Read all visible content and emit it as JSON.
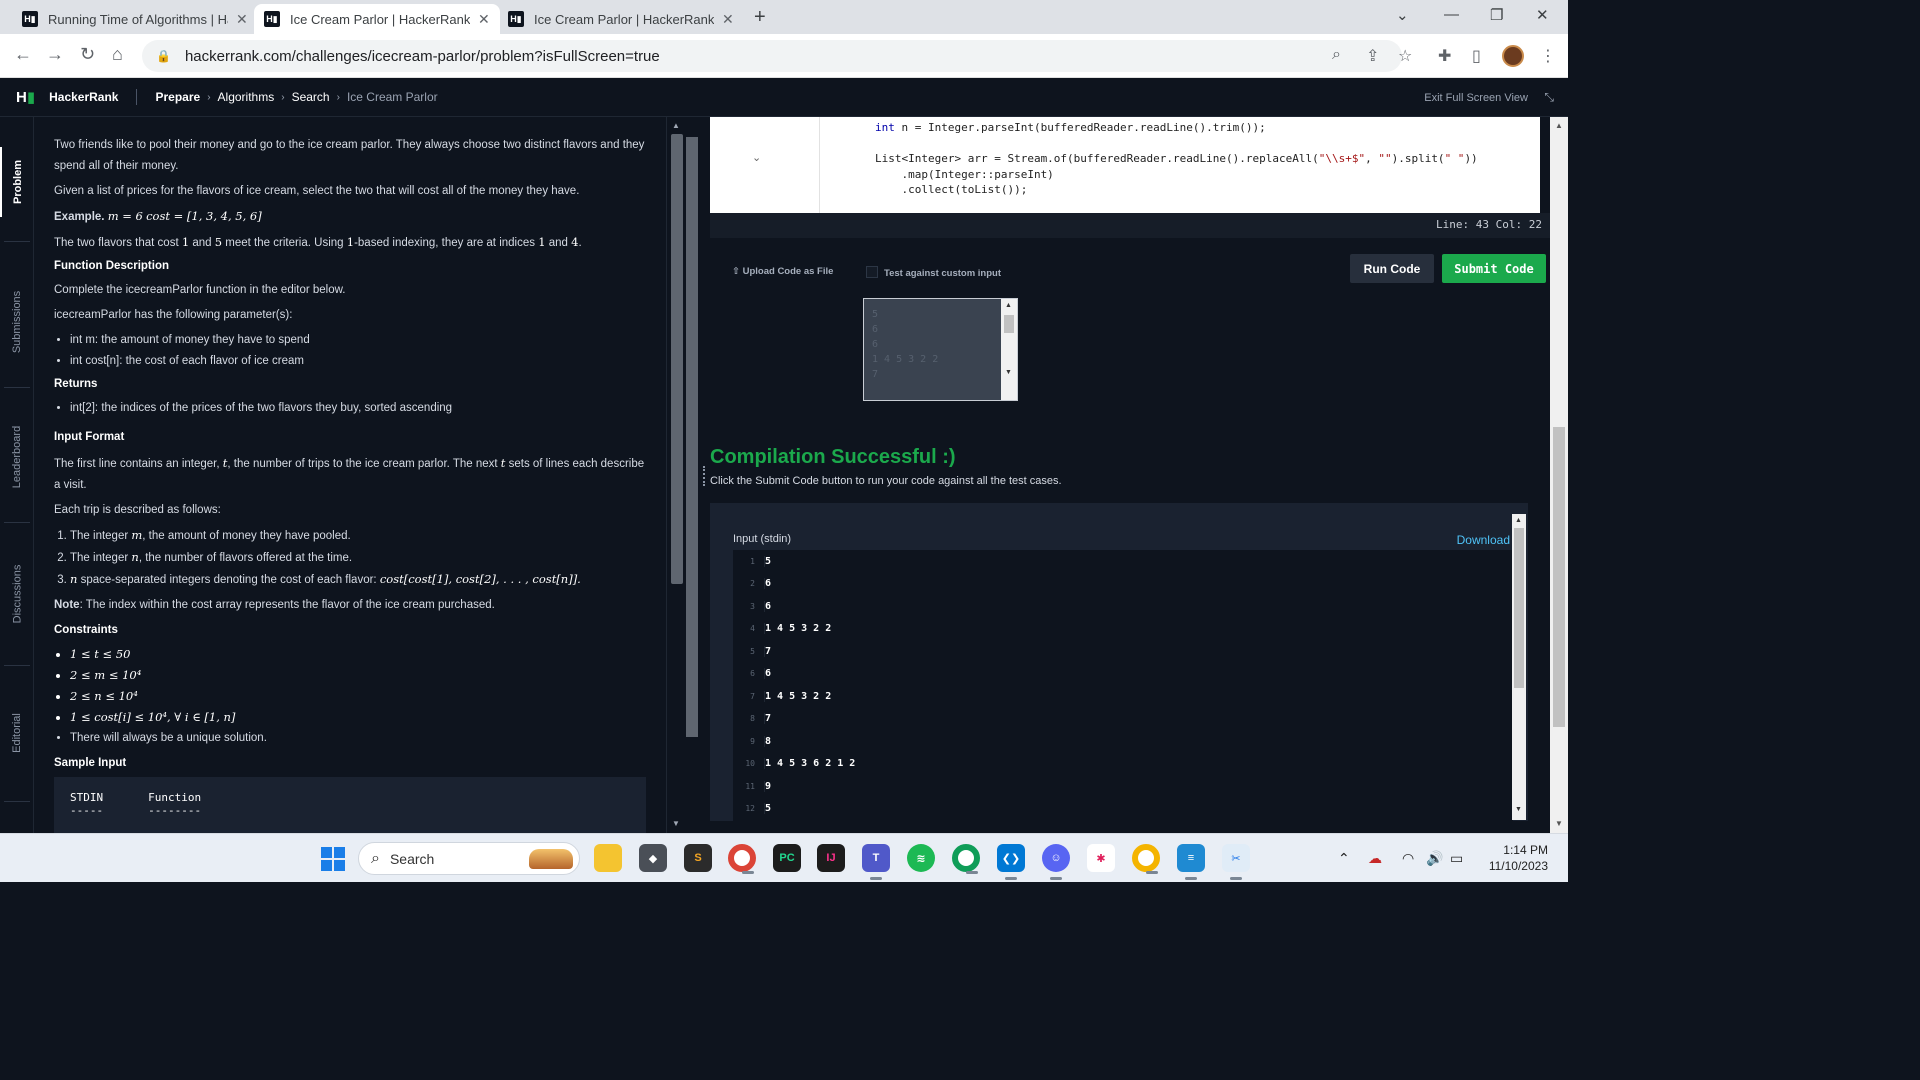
{
  "browser": {
    "tabs": [
      {
        "label": "Running Time of Algorithms | Ha",
        "active": false
      },
      {
        "label": "Ice Cream Parlor | HackerRank",
        "active": true
      },
      {
        "label": "Ice Cream Parlor | HackerRank",
        "active": false
      }
    ],
    "url": "hackerrank.com/challenges/icecream-parlor/problem?isFullScreen=true"
  },
  "header": {
    "logo": "H",
    "brand": "HackerRank",
    "breadcrumbs": [
      "Prepare",
      "Algorithms",
      "Search",
      "Ice Cream Parlor"
    ],
    "exit_fullscreen": "Exit Full Screen View"
  },
  "side_nav": [
    "Problem",
    "Submissions",
    "Leaderboard",
    "Discussions",
    "Editorial"
  ],
  "problem": {
    "intro": "Two friends like to pool their money and go to the ice cream parlor. They always choose two distinct flavors and they spend all of their money.",
    "given": "Given a list of prices for the flavors of ice cream, select the two that will cost all of the money they have.",
    "example_label": "Example.",
    "example_m": "m = 6",
    "example_cost": "cost = [1, 3, 4, 5, 6]",
    "example_text_a": "The two flavors that cost",
    "example_v1": "1",
    "example_text_b": "and",
    "example_v2": "5",
    "example_text_c": "meet the criteria. Using",
    "example_v3": "1",
    "example_text_d": "-based indexing, they are at indices",
    "example_v4": "1",
    "example_text_e": "and",
    "example_v5": "4",
    "example_text_f": ".",
    "func_desc_title": "Function Description",
    "func_desc": "Complete the icecreamParlor function in the editor below.",
    "params_intro": "icecreamParlor has the following parameter(s):",
    "params": [
      "int m: the amount of money they have to spend",
      "int cost[n]: the cost of each flavor of ice cream"
    ],
    "returns_title": "Returns",
    "returns": [
      "int[2]: the indices of the prices of the two flavors they buy, sorted ascending"
    ],
    "input_format_title": "Input Format",
    "input_a": "The first line contains an integer,",
    "input_t1": "t",
    "input_b": ", the number of trips to the ice cream parlor. The next",
    "input_t2": "t",
    "input_c": "sets of lines each describe a visit.",
    "trip_intro": "Each trip is described as follows:",
    "trip_1a": "The integer",
    "trip_1m": "m",
    "trip_1b": ", the amount of money they have pooled.",
    "trip_2a": "The integer",
    "trip_2n": "n",
    "trip_2b": ", the number of flavors offered at the time.",
    "trip_3n": "n",
    "trip_3a": "space-separated integers denoting the cost of each flavor:",
    "trip_3math": "cost[cost[1], cost[2], . . . , cost[n]].",
    "note_label": "Note",
    "note": ": The index within the cost array represents the flavor of the ice cream purchased.",
    "constraints_title": "Constraints",
    "constraints": [
      "1 ≤ t ≤ 50",
      "2 ≤ m ≤ 10⁴",
      "2 ≤ n ≤ 10⁴",
      "1 ≤ cost[i] ≤ 10⁴, ∀ i ∈ [1, n]"
    ],
    "constraint_note": "There will always be a unique solution.",
    "sample_input_title": "Sample Input",
    "sample_col1": "STDIN",
    "sample_col2": "Function",
    "sample_dash1": "-----",
    "sample_dash2": "--------"
  },
  "editor": {
    "line1_a": "int",
    "line1_b": " n = Integer.parseInt(bufferedReader.readLine().trim());",
    "line2_a": "List<Integer> arr = Stream.of(bufferedReader.readLine().replaceAll(",
    "line2_s1": "\"\\\\s+$\"",
    "line2_b": ", ",
    "line2_s2": "\"\"",
    "line2_c": ").split(",
    "line2_s3": "\" \"",
    "line2_d": "))",
    "line3": "    .map(Integer::parseInt)",
    "line4": "    .collect(toList());",
    "cursor_pos": "Line: 43 Col: 22"
  },
  "actions": {
    "upload": "Upload Code as File",
    "custom_input": "Test against custom input",
    "run": "Run Code",
    "submit": "Submit Code",
    "custom_input_text": "5\n6\n6\n1 4 5 3 2 2\n7"
  },
  "result": {
    "title": "Compilation Successful :)",
    "subtitle": "Click the Submit Code button to run your code against all the test cases.",
    "stdin_label": "Input (stdin)",
    "download": "Download",
    "stdin_lines": [
      "5",
      "6",
      "6",
      "1 4 5 3 2 2",
      "7",
      "6",
      "1 4 5 3 2 2",
      "7",
      "8",
      "1 4 5 3 6 2 1 2",
      "9",
      "5"
    ]
  },
  "taskbar": {
    "search": "Search",
    "time": "1:14 PM",
    "date": "11/10/2023"
  },
  "colors": {
    "accent_green": "#1ba94c",
    "bg_dark": "#0e141e",
    "link_blue": "#4fc3f7"
  }
}
